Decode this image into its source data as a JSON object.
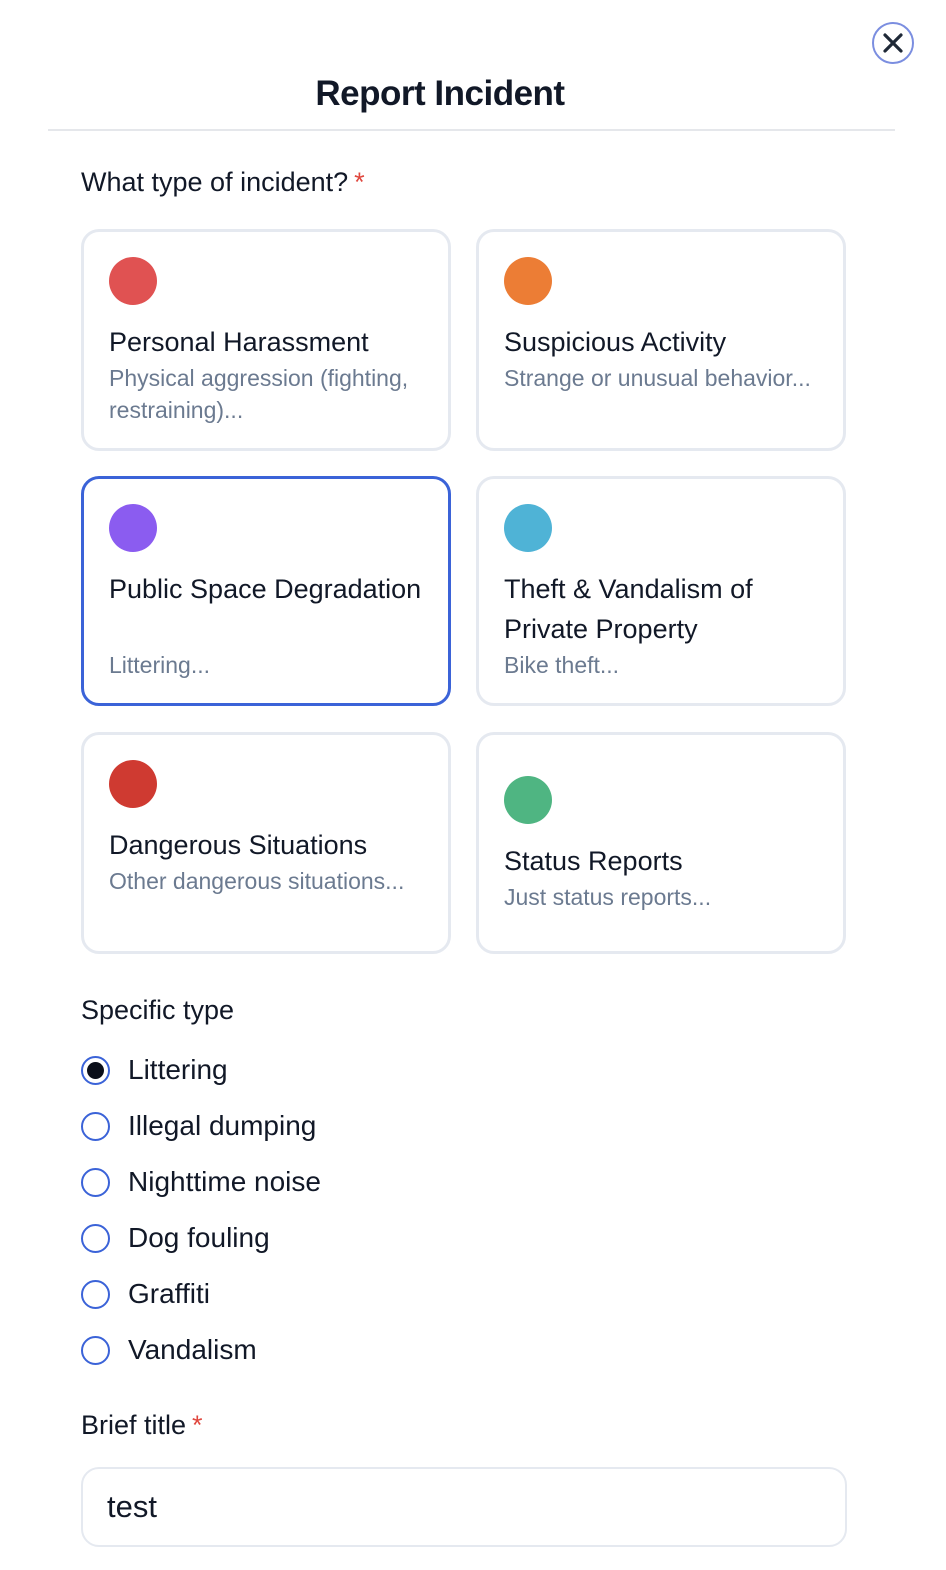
{
  "modal": {
    "title": "Report Incident",
    "close_icon": "close-icon"
  },
  "incident_type": {
    "label": "What type of incident?",
    "required_mark": "*",
    "options": [
      {
        "title": "Personal Harassment",
        "description": "Physical aggression (fighting, restraining)...",
        "color": "#e05252",
        "selected": false
      },
      {
        "title": "Suspicious Activity",
        "description": "Strange or unusual behavior...",
        "color": "#ec7d35",
        "selected": false
      },
      {
        "title": "Public Space Degradation",
        "description": "Littering...",
        "color": "#8b5cf0",
        "selected": true
      },
      {
        "title": "Theft & Vandalism of Private Property",
        "description": "Bike theft...",
        "color": "#4fb3d6",
        "selected": false
      },
      {
        "title": "Dangerous Situations",
        "description": "Other dangerous situations...",
        "color": "#cf3a31",
        "selected": false
      },
      {
        "title": "Status Reports",
        "description": "Just status reports...",
        "color": "#4fb582",
        "selected": false
      }
    ]
  },
  "specific_type": {
    "label": "Specific type",
    "options": [
      {
        "label": "Littering",
        "checked": true
      },
      {
        "label": "Illegal dumping",
        "checked": false
      },
      {
        "label": "Nighttime noise",
        "checked": false
      },
      {
        "label": "Dog fouling",
        "checked": false
      },
      {
        "label": "Graffiti",
        "checked": false
      },
      {
        "label": "Vandalism",
        "checked": false
      }
    ]
  },
  "brief_title": {
    "label": "Brief title",
    "required_mark": "*",
    "value": "test"
  },
  "colors": {
    "accent": "#3b63d8",
    "required": "#e0473e",
    "muted_text": "#6b7a90",
    "card_border": "#e5e9f0"
  }
}
